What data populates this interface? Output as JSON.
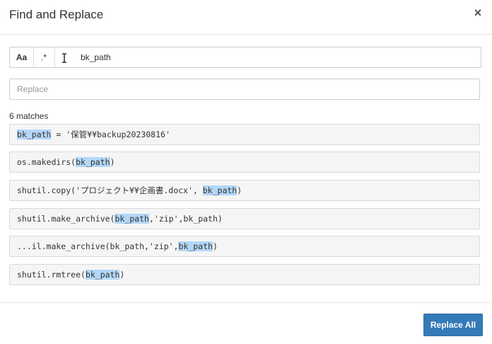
{
  "dialog": {
    "title": "Find and Replace",
    "close_glyph": "×"
  },
  "find": {
    "case_label": "Aa",
    "regex_label": ".*",
    "cursor_icon": "text-cursor-icon",
    "cursor_glyph": "I",
    "value": "bk_path"
  },
  "replace": {
    "placeholder": "Replace"
  },
  "results": {
    "count_text": "6 matches",
    "items": [
      {
        "before": "",
        "match": "bk_path",
        "after": " = '保管¥¥backup20230816'"
      },
      {
        "before": "os.makedirs(",
        "match": "bk_path",
        "after": ")"
      },
      {
        "before": "shutil.copy('プロジェクト¥¥企画書.docx', ",
        "match": "bk_path",
        "after": ")"
      },
      {
        "before": "shutil.make_archive(",
        "match": "bk_path",
        "after": ",'zip',bk_path)"
      },
      {
        "before": "...il.make_archive(bk_path,'zip',",
        "match": "bk_path",
        "after": ")"
      },
      {
        "before": "shutil.rmtree(",
        "match": "bk_path",
        "after": ")"
      }
    ]
  },
  "footer": {
    "replace_all_label": "Replace All"
  },
  "colors": {
    "highlight": "#b3d7f7",
    "primary_button": "#337ab7"
  }
}
